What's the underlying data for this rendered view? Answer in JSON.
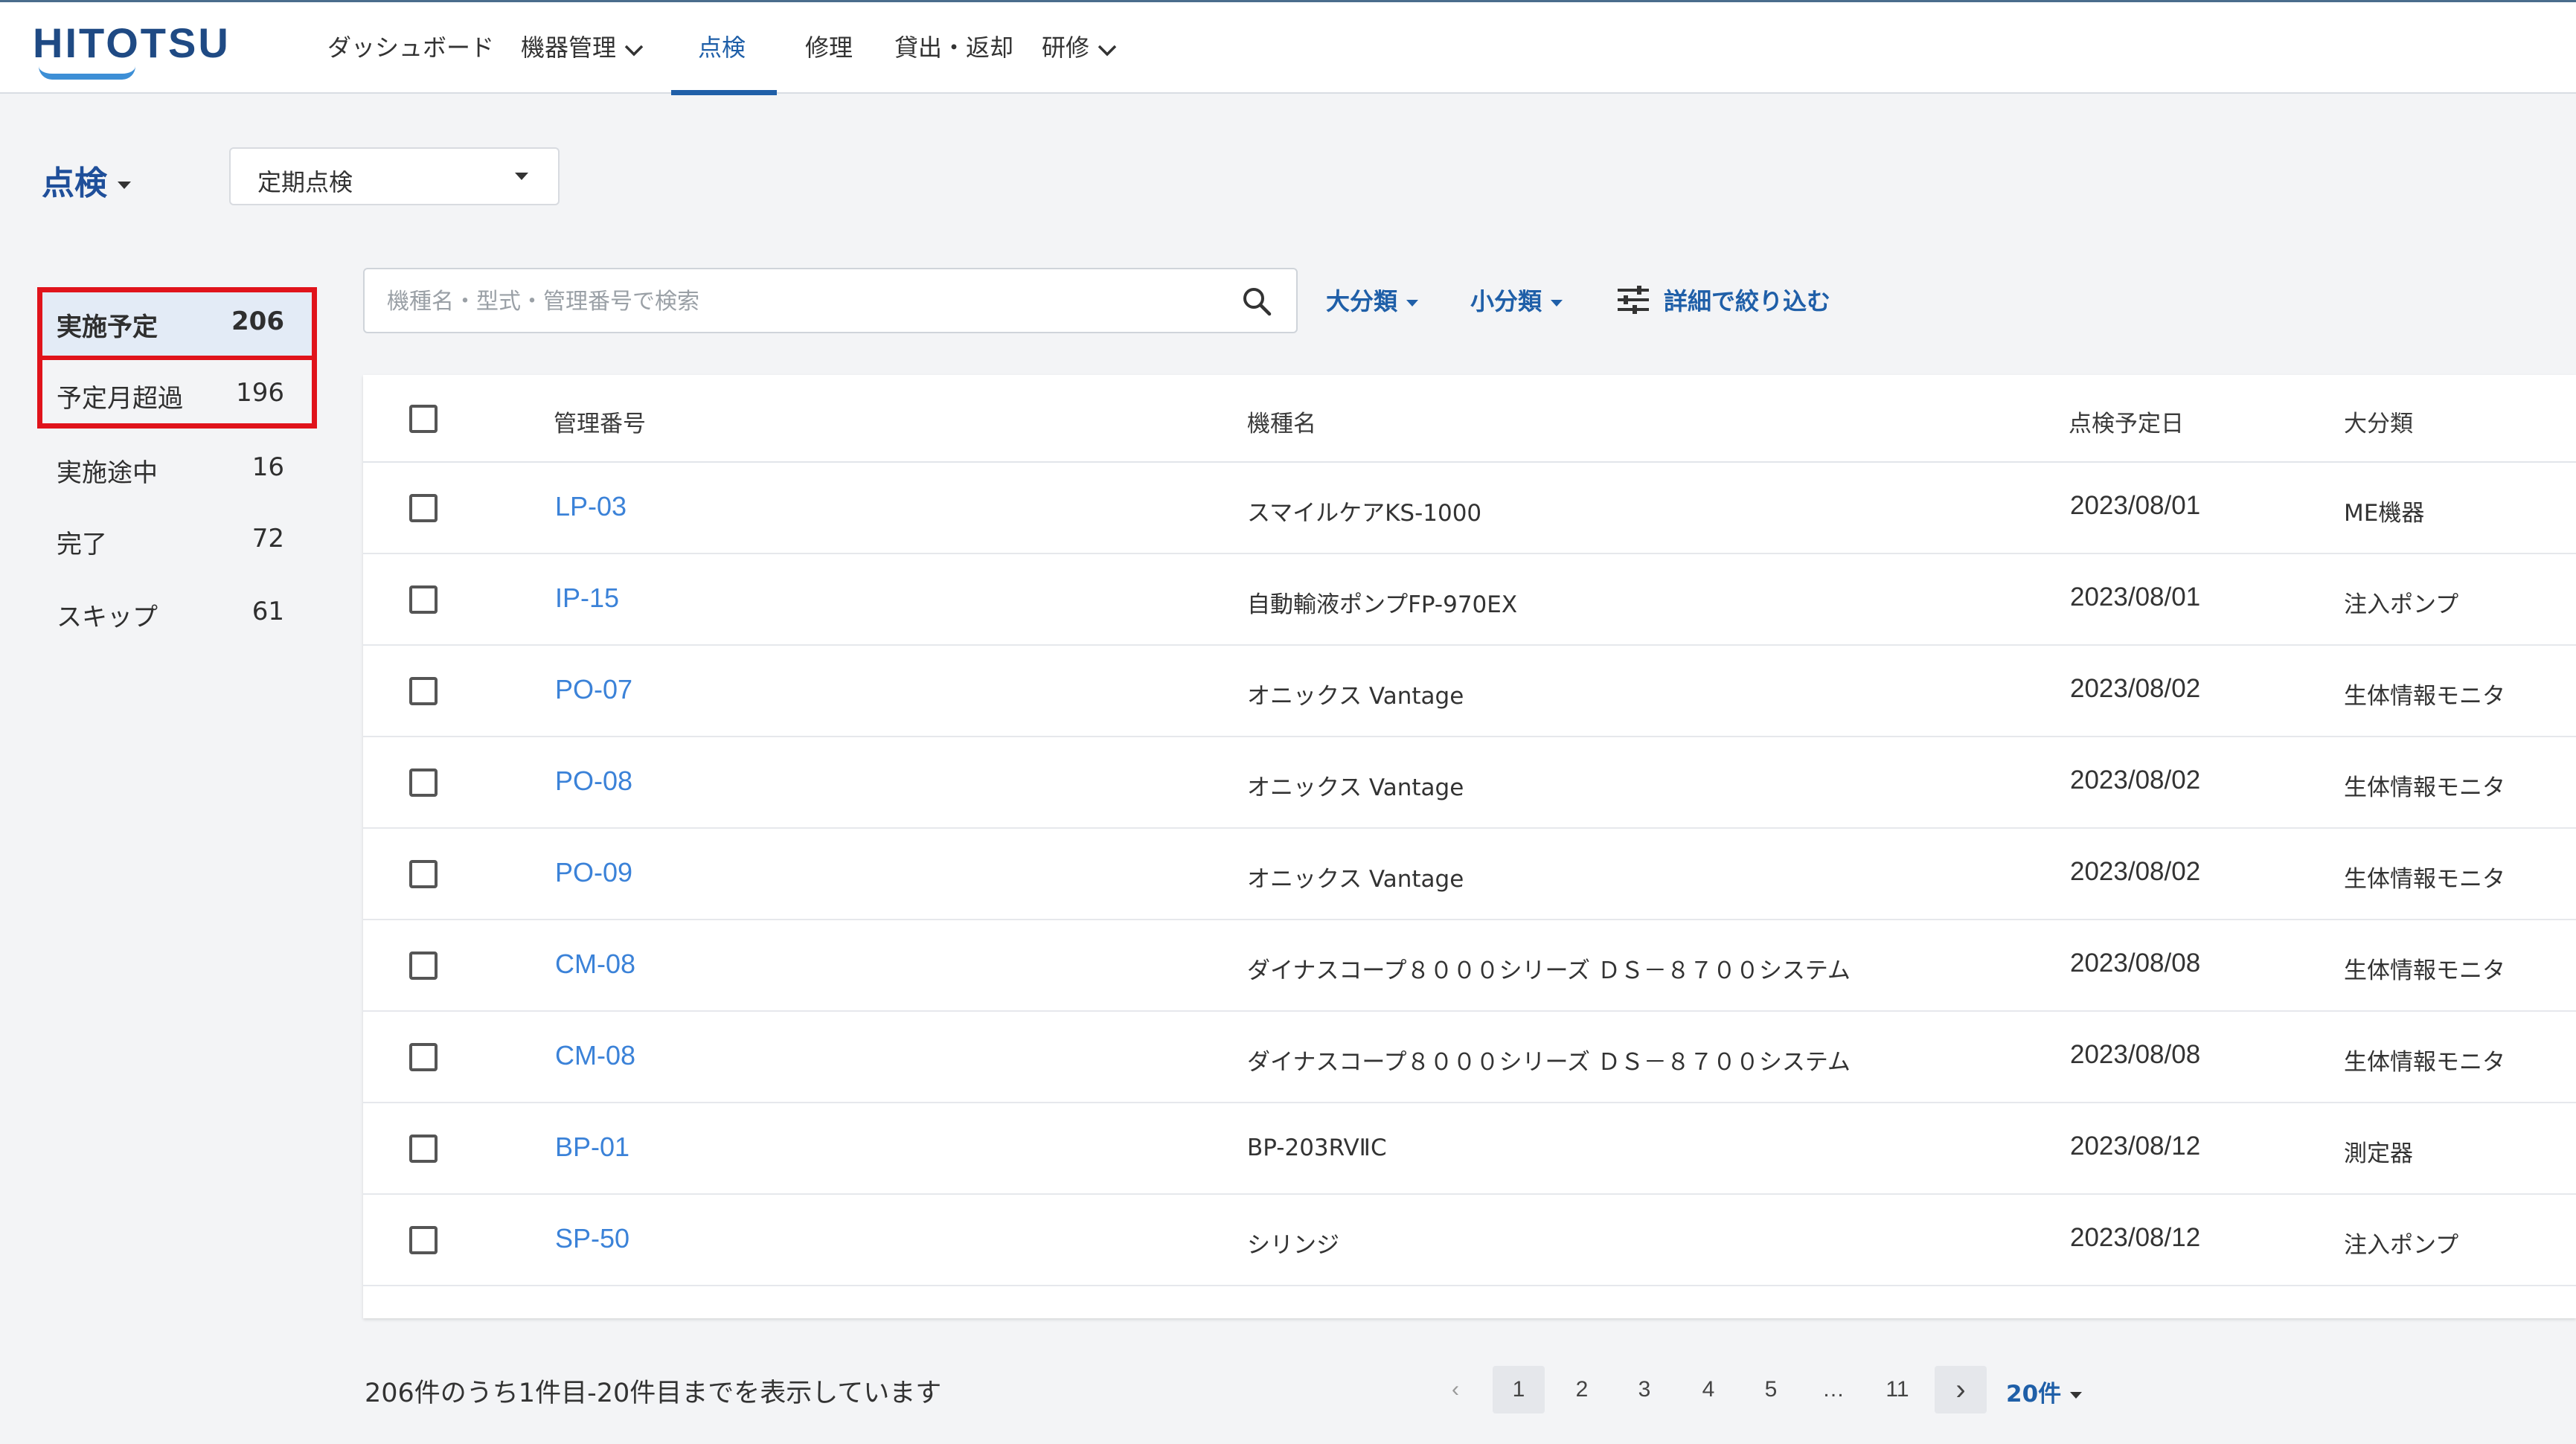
{
  "app": {
    "logo": "HITOTSU"
  },
  "nav": {
    "dashboard": "ダッシュボード",
    "devices": "機器管理",
    "inspection": "点検",
    "repair": "修理",
    "lending": "貸出・返却",
    "training": "研修"
  },
  "page": {
    "title": "点検",
    "type_select": "定期点検"
  },
  "sidebar": {
    "items": [
      {
        "label": "実施予定",
        "count": "206"
      },
      {
        "label": "予定月超過",
        "count": "196"
      },
      {
        "label": "実施途中",
        "count": "16"
      },
      {
        "label": "完了",
        "count": "72"
      },
      {
        "label": "スキップ",
        "count": "61"
      }
    ]
  },
  "search": {
    "placeholder": "機種名・型式・管理番号で検索",
    "value": ""
  },
  "filters": {
    "large_category": "大分類",
    "small_category": "小分類",
    "detail": "詳細で絞り込む"
  },
  "table": {
    "headers": {
      "id": "管理番号",
      "model": "機種名",
      "date": "点検予定日",
      "category": "大分類"
    },
    "rows": [
      {
        "id": "LP-03",
        "model": "スマイルケアKS-1000",
        "date": "2023/08/01",
        "category": "ME機器"
      },
      {
        "id": "IP-15",
        "model": "自動輸液ポンプFP-970EX",
        "date": "2023/08/01",
        "category": "注入ポンプ"
      },
      {
        "id": "PO-07",
        "model": "オニックス Vantage",
        "date": "2023/08/02",
        "category": "生体情報モニタ"
      },
      {
        "id": "PO-08",
        "model": "オニックス Vantage",
        "date": "2023/08/02",
        "category": "生体情報モニタ"
      },
      {
        "id": "PO-09",
        "model": "オニックス Vantage",
        "date": "2023/08/02",
        "category": "生体情報モニタ"
      },
      {
        "id": "CM-08",
        "model": "ダイナスコープ８０００シリーズ ＤＳ－８７００システム",
        "date": "2023/08/08",
        "category": "生体情報モニタ"
      },
      {
        "id": "CM-08",
        "model": "ダイナスコープ８０００シリーズ ＤＳ－８７００システム",
        "date": "2023/08/08",
        "category": "生体情報モニタ"
      },
      {
        "id": "BP-01",
        "model": "BP-203RVⅡC",
        "date": "2023/08/12",
        "category": "測定器"
      },
      {
        "id": "SP-50",
        "model": "シリンジ",
        "date": "2023/08/12",
        "category": "注入ポンプ"
      }
    ]
  },
  "pagination": {
    "summary": "206件のうち1件目-20件目までを表示しています",
    "prev": "‹",
    "pages": [
      "1",
      "2",
      "3",
      "4",
      "5",
      "…",
      "11"
    ],
    "next": "›",
    "per_page": "20件",
    "current_page": "1"
  },
  "colors": {
    "brand": "#1f4a84",
    "accent": "#1f5fa8",
    "link": "#3b82d8",
    "highlight": "#e0131b"
  }
}
